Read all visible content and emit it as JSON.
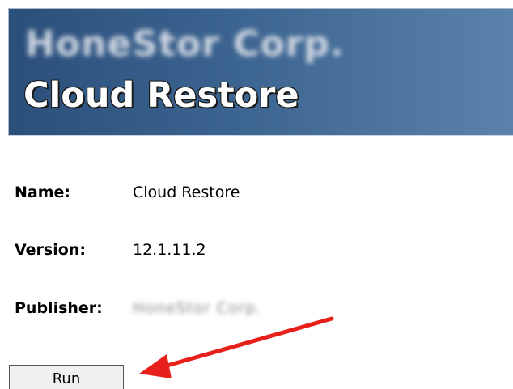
{
  "banner": {
    "company": "HoneStor Corp.",
    "product": "Cloud Restore"
  },
  "info": {
    "name_label": "Name:",
    "name_value": "Cloud Restore",
    "version_label": "Version:",
    "version_value": "12.1.11.2",
    "publisher_label": "Publisher:",
    "publisher_value": "HoneStor Corp."
  },
  "actions": {
    "run_label": "Run"
  },
  "annotation": {
    "arrow_color": "#e8201c",
    "arrow_icon": "red-arrow-icon"
  }
}
